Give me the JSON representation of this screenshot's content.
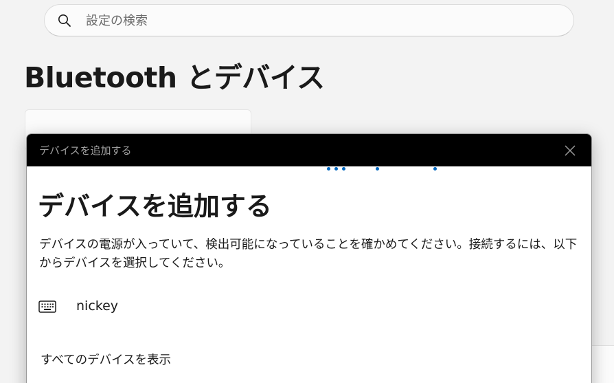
{
  "search": {
    "placeholder": "設定の検索",
    "icon": "search-icon"
  },
  "page": {
    "title": "Bluetooth とデバイス"
  },
  "dialog": {
    "window_title": "デバイスを追加する",
    "heading": "デバイスを追加する",
    "description": "デバイスの電源が入っていて、検出可能になっていることを確かめてください。接続するには、以下からデバイスを選択してください。",
    "close_icon": "close-icon",
    "accent_color": "#0067c0",
    "devices": [
      {
        "name": "nickey",
        "icon": "keyboard-icon"
      }
    ],
    "show_all_label": "すべてのデバイスを表示"
  }
}
